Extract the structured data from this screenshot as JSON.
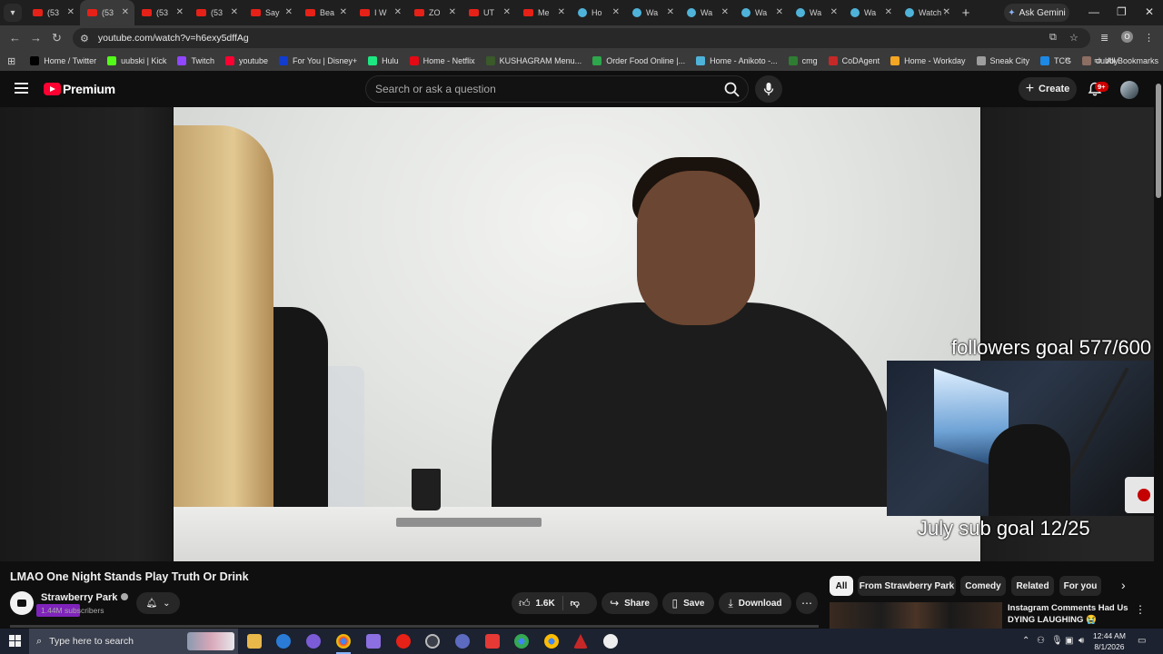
{
  "browser": {
    "tabs": [
      {
        "label": "(53",
        "kind": "yt"
      },
      {
        "label": "(53",
        "kind": "yt",
        "active": true
      },
      {
        "label": "(53",
        "kind": "yt"
      },
      {
        "label": "(53",
        "kind": "yt"
      },
      {
        "label": "Say",
        "kind": "yt"
      },
      {
        "label": "Bea",
        "kind": "yt"
      },
      {
        "label": "I W",
        "kind": "yt"
      },
      {
        "label": "ZO",
        "kind": "yt"
      },
      {
        "label": "UT",
        "kind": "yt"
      },
      {
        "label": "Me",
        "kind": "yt"
      },
      {
        "label": "Ho",
        "kind": "globe"
      },
      {
        "label": "Wa",
        "kind": "globe"
      },
      {
        "label": "Wa",
        "kind": "globe"
      },
      {
        "label": "Wa",
        "kind": "globe"
      },
      {
        "label": "Wa",
        "kind": "globe"
      },
      {
        "label": "Wa",
        "kind": "globe"
      },
      {
        "label": "Watch T",
        "kind": "globe"
      }
    ],
    "gemini_label": "Ask Gemini",
    "url": "youtube.com/watch?v=h6exy5dffAg",
    "profile_initial": "O",
    "bookmarks": [
      {
        "label": "Home / Twitter",
        "color": "#000000"
      },
      {
        "label": "uubski | Kick",
        "color": "#53fc18"
      },
      {
        "label": "Twitch",
        "color": "#9146ff"
      },
      {
        "label": "youtube",
        "color": "#ff0033"
      },
      {
        "label": "For You | Disney+",
        "color": "#113ccf"
      },
      {
        "label": "Hulu",
        "color": "#1ce783"
      },
      {
        "label": "Home - Netflix",
        "color": "#e50914"
      },
      {
        "label": "KUSHAGRAM Menu...",
        "color": "#3a5a2a"
      },
      {
        "label": "Order Food Online |...",
        "color": "#2ea64b"
      },
      {
        "label": "Home - Anikoto -...",
        "color": "#4fb3d9"
      },
      {
        "label": "cmg",
        "color": "#2e7d32"
      },
      {
        "label": "CoDAgent",
        "color": "#c62828"
      },
      {
        "label": "Home - Workday",
        "color": "#f5a623"
      },
      {
        "label": "Sneak City",
        "color": "#9e9e9e"
      },
      {
        "label": "TCG",
        "color": "#1e88e5"
      },
      {
        "label": "dubby",
        "color": "#8d6e63"
      }
    ],
    "all_bookmarks_label": "All Bookmarks"
  },
  "youtube": {
    "brand": "Premium",
    "search_placeholder": "Search or ask a question",
    "create_label": "Create",
    "notification_badge": "9+",
    "overlay": {
      "followers_goal": "followers goal 577/600",
      "sub_goal": "July sub goal 12/25"
    },
    "video": {
      "title": "LMAO One Night Stands Play Truth Or Drink",
      "channel": "Strawberry Park",
      "subscribers": "1.44M subscribers",
      "likes": "1.6K",
      "share_label": "Share",
      "save_label": "Save",
      "download_label": "Download"
    },
    "chips": [
      "All",
      "From Strawberry Park",
      "Comedy",
      "Related",
      "For you"
    ],
    "related": {
      "title": "Instagram Comments Had Us DYING LAUGHING 😭"
    }
  },
  "taskbar": {
    "search_placeholder": "Type here to search",
    "time": "12:44 AM",
    "date": "8/1/2026"
  }
}
